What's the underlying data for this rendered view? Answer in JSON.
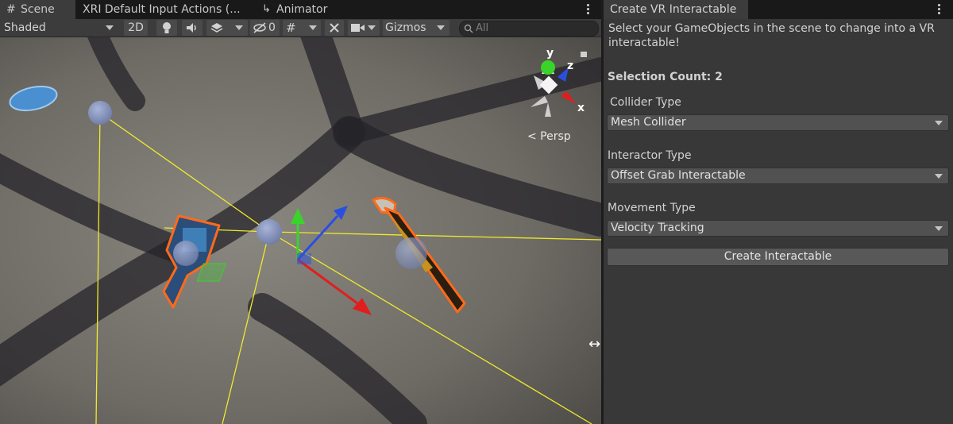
{
  "tabs": [
    {
      "label": "Scene",
      "icon": "grid-icon"
    },
    {
      "label": "XRI Default Input Actions (...",
      "icon": ""
    },
    {
      "label": "Animator",
      "icon": "animator-icon"
    }
  ],
  "toolbar": {
    "draw_mode": "Shaded",
    "toggle_2d": "2D",
    "hidden_count": "0",
    "gizmos": "Gizmos",
    "search_placeholder": "All"
  },
  "scene": {
    "projection_label": "< Persp",
    "axis_labels": {
      "x": "x",
      "y": "y",
      "z": "z"
    }
  },
  "panel": {
    "tab_title": "Create VR Interactable",
    "description": "Select your GameObjects in the scene to change into a VR interactable!",
    "selection_count": "Selection Count: 2",
    "collider_type": {
      "label": "Collider Type",
      "value": "Mesh Collider"
    },
    "interactor_type": {
      "label": "Interactor Type",
      "value": "Offset Grab Interactable"
    },
    "movement_type": {
      "label": "Movement Type",
      "value": "Velocity Tracking"
    },
    "create_button": "Create Interactable"
  },
  "colors": {
    "selection_outline": "#ff6a1a",
    "gizmo_x": "#e01e1e",
    "gizmo_y": "#39d42a",
    "gizmo_z": "#2a4fe0",
    "collider_lines": "#f0ea2a",
    "panel_bg": "#383838"
  }
}
